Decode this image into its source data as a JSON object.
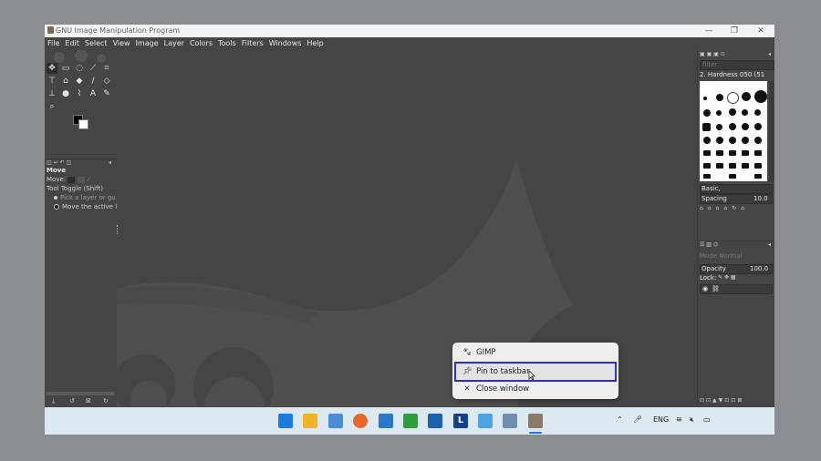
{
  "window": {
    "title": "GNU Image Manipulation Program",
    "controls": {
      "minimize": "—",
      "restore": "❐",
      "close": "✕"
    }
  },
  "menubar": {
    "items": [
      "File",
      "Edit",
      "Select",
      "View",
      "Image",
      "Layer",
      "Colors",
      "Tools",
      "Filters",
      "Windows",
      "Help"
    ]
  },
  "tool_options": {
    "title": "Move",
    "move_label": "Move:",
    "toggle_label": "Tool Toggle  (Shift)",
    "option1": "Pick a layer or gu",
    "option2": "Move the active l"
  },
  "brushes": {
    "filter_placeholder": "filter",
    "selected_brush": "2. Hardness 050 (51",
    "tag": "Basic,",
    "spacing_label": "Spacing",
    "spacing_value": "10.0"
  },
  "layers": {
    "mode": "Mode Normal",
    "opacity_label": "Opacity",
    "opacity_value": "100.0",
    "lock_label": "Lock:"
  },
  "context_menu": {
    "items": [
      {
        "label": "GIMP",
        "icon": "gimp-icon"
      },
      {
        "label": "Pin to taskbar",
        "icon": "pin-icon"
      },
      {
        "label": "Close window",
        "icon": "close-icon"
      }
    ]
  },
  "taskbar": {
    "language": "ENG",
    "icons": [
      "windows-start-icon",
      "file-explorer-icon",
      "photos-icon",
      "firefox-icon",
      "writer-icon",
      "calc-icon",
      "store-icon",
      "libreoffice-icon",
      "vscode-icon",
      "paint-icon",
      "gimp-icon"
    ]
  },
  "colors": {
    "accent": "#2b2fd6",
    "taskbar_bg": "#dce9f1",
    "app_bg": "#454545"
  }
}
